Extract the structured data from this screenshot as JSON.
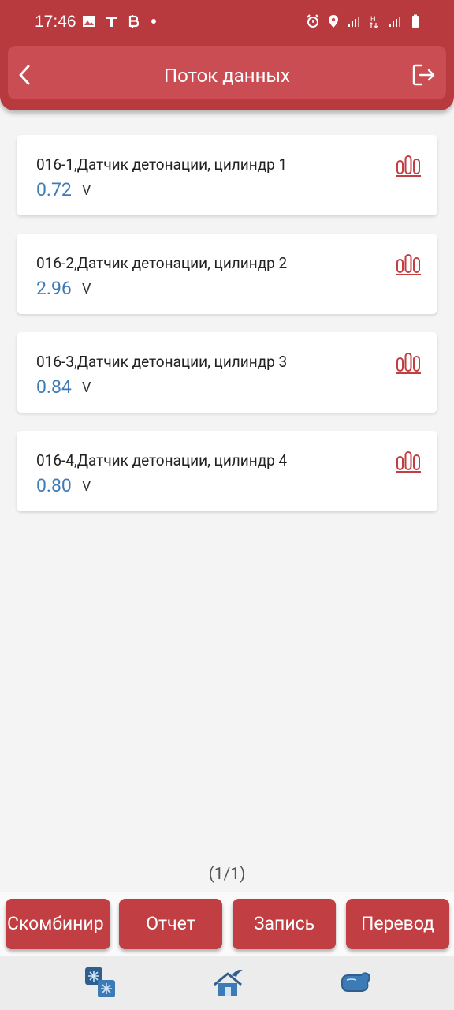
{
  "status_bar": {
    "time": "17:46"
  },
  "header": {
    "title": "Поток данных"
  },
  "items": [
    {
      "name": "016-1,Датчик детонации, цилиндр 1",
      "value": "0.72",
      "unit": "V"
    },
    {
      "name": "016-2,Датчик детонации, цилиндр 2",
      "value": "2.96",
      "unit": "V"
    },
    {
      "name": "016-3,Датчик детонации, цилиндр 3",
      "value": "0.84",
      "unit": "V"
    },
    {
      "name": "016-4,Датчик детонации, цилиндр 4",
      "value": "0.80",
      "unit": "V"
    }
  ],
  "pagination": {
    "label": "(1/1)"
  },
  "buttons": {
    "combine": "Скомбинир",
    "report": "Отчет",
    "record": "Запись",
    "translate": "Перевод"
  },
  "tabs": {
    "icons": [
      "snowflake-icon",
      "home-icon",
      "glove-icon"
    ]
  },
  "colors": {
    "header": "#b83a3f",
    "value_text": "#3d7bb6",
    "button": "#c13e42"
  }
}
